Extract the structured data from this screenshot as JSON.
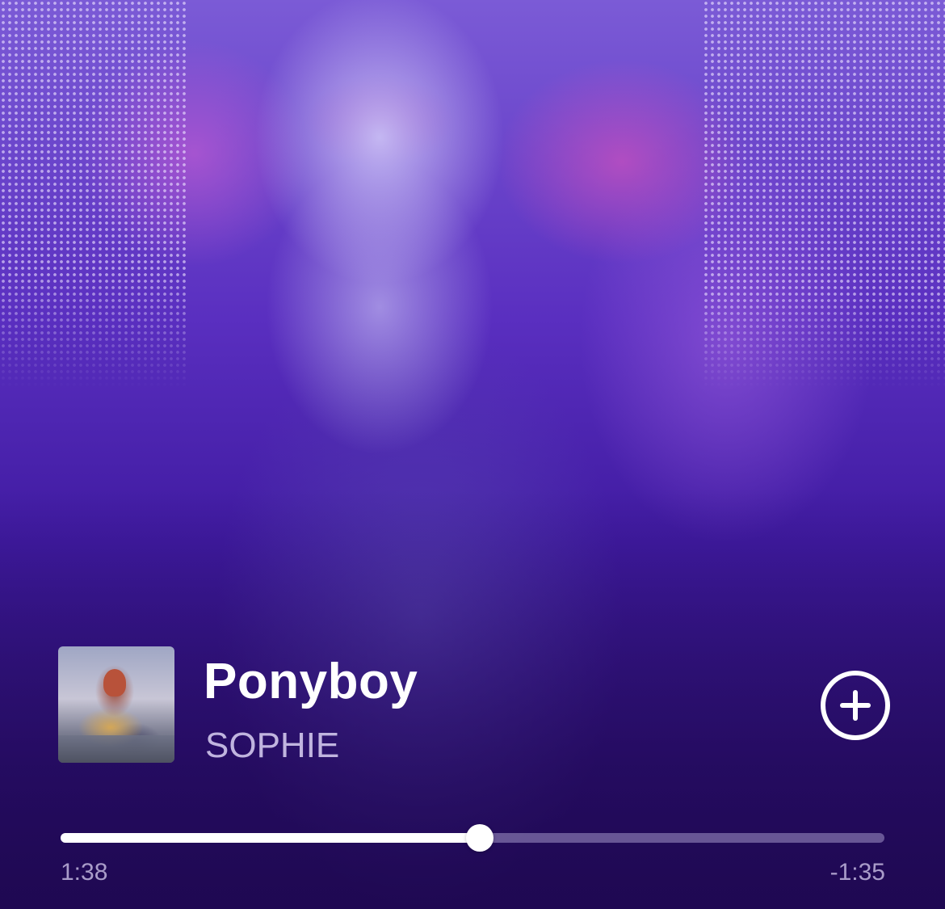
{
  "now_playing": {
    "title": "Ponyboy",
    "artist": "SOPHIE",
    "add_icon": "plus-circle-icon"
  },
  "playback": {
    "elapsed": "1:38",
    "remaining": "-1:35",
    "progress_fraction": 0.509
  },
  "colors": {
    "accent": "#ffffff",
    "background": "#2a0f63"
  }
}
